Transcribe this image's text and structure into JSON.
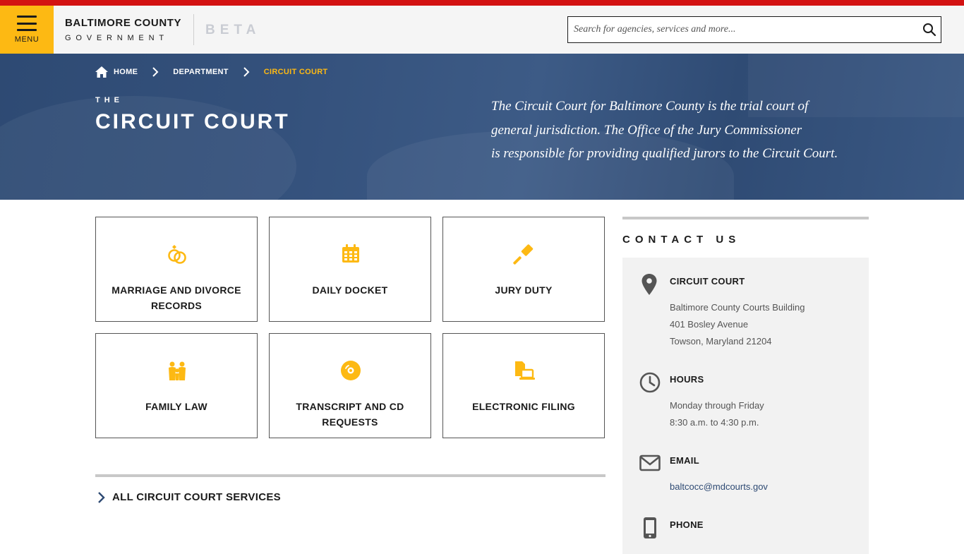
{
  "header": {
    "menu_label": "MENU",
    "logo_line1": "BALTIMORE COUNTY",
    "logo_line2": "GOVERNMENT",
    "beta": "BETA",
    "search_placeholder": "Search for agencies, services and more..."
  },
  "colors": {
    "accent_yellow": "#fdb913",
    "top_red": "#d31212",
    "hero_blue": "#34517c"
  },
  "breadcrumb": {
    "home": "HOME",
    "department": "DEPARTMENT",
    "current": "CIRCUIT COURT"
  },
  "hero": {
    "pre_title": "THE",
    "title": "CIRCUIT COURT",
    "desc_line1": "The Circuit Court for Baltimore County is the trial court of",
    "desc_line2": "general jurisdiction. The Office of the Jury Commissioner",
    "desc_line3": "is responsible for providing qualified jurors to the Circuit Court."
  },
  "tiles": [
    {
      "label_line1": "MARRIAGE AND DIVORCE",
      "label_line2": "RECORDS",
      "icon": "rings-icon"
    },
    {
      "label_line1": "DAILY DOCKET",
      "label_line2": "",
      "icon": "calendar-icon"
    },
    {
      "label_line1": "JURY DUTY",
      "label_line2": "",
      "icon": "gavel-icon"
    },
    {
      "label_line1": "FAMILY LAW",
      "label_line2": "",
      "icon": "family-icon"
    },
    {
      "label_line1": "TRANSCRIPT AND CD",
      "label_line2": "REQUESTS",
      "icon": "disc-icon"
    },
    {
      "label_line1": "ELECTRONIC FILING",
      "label_line2": "",
      "icon": "efiling-icon"
    }
  ],
  "all_services": "ALL CIRCUIT COURT SERVICES",
  "contact": {
    "title": "CONTACT US",
    "address_head": "CIRCUIT COURT",
    "address_line1": "Baltimore County Courts Building",
    "address_line2": "401 Bosley Avenue",
    "address_line3": "Towson, Maryland 21204",
    "hours_head": "HOURS",
    "hours_line1": "Monday through Friday",
    "hours_line2": "8:30 a.m. to 4:30 p.m.",
    "email_head": "EMAIL",
    "email": "baltcocc@mdcourts.gov",
    "phone_head": "PHONE"
  }
}
